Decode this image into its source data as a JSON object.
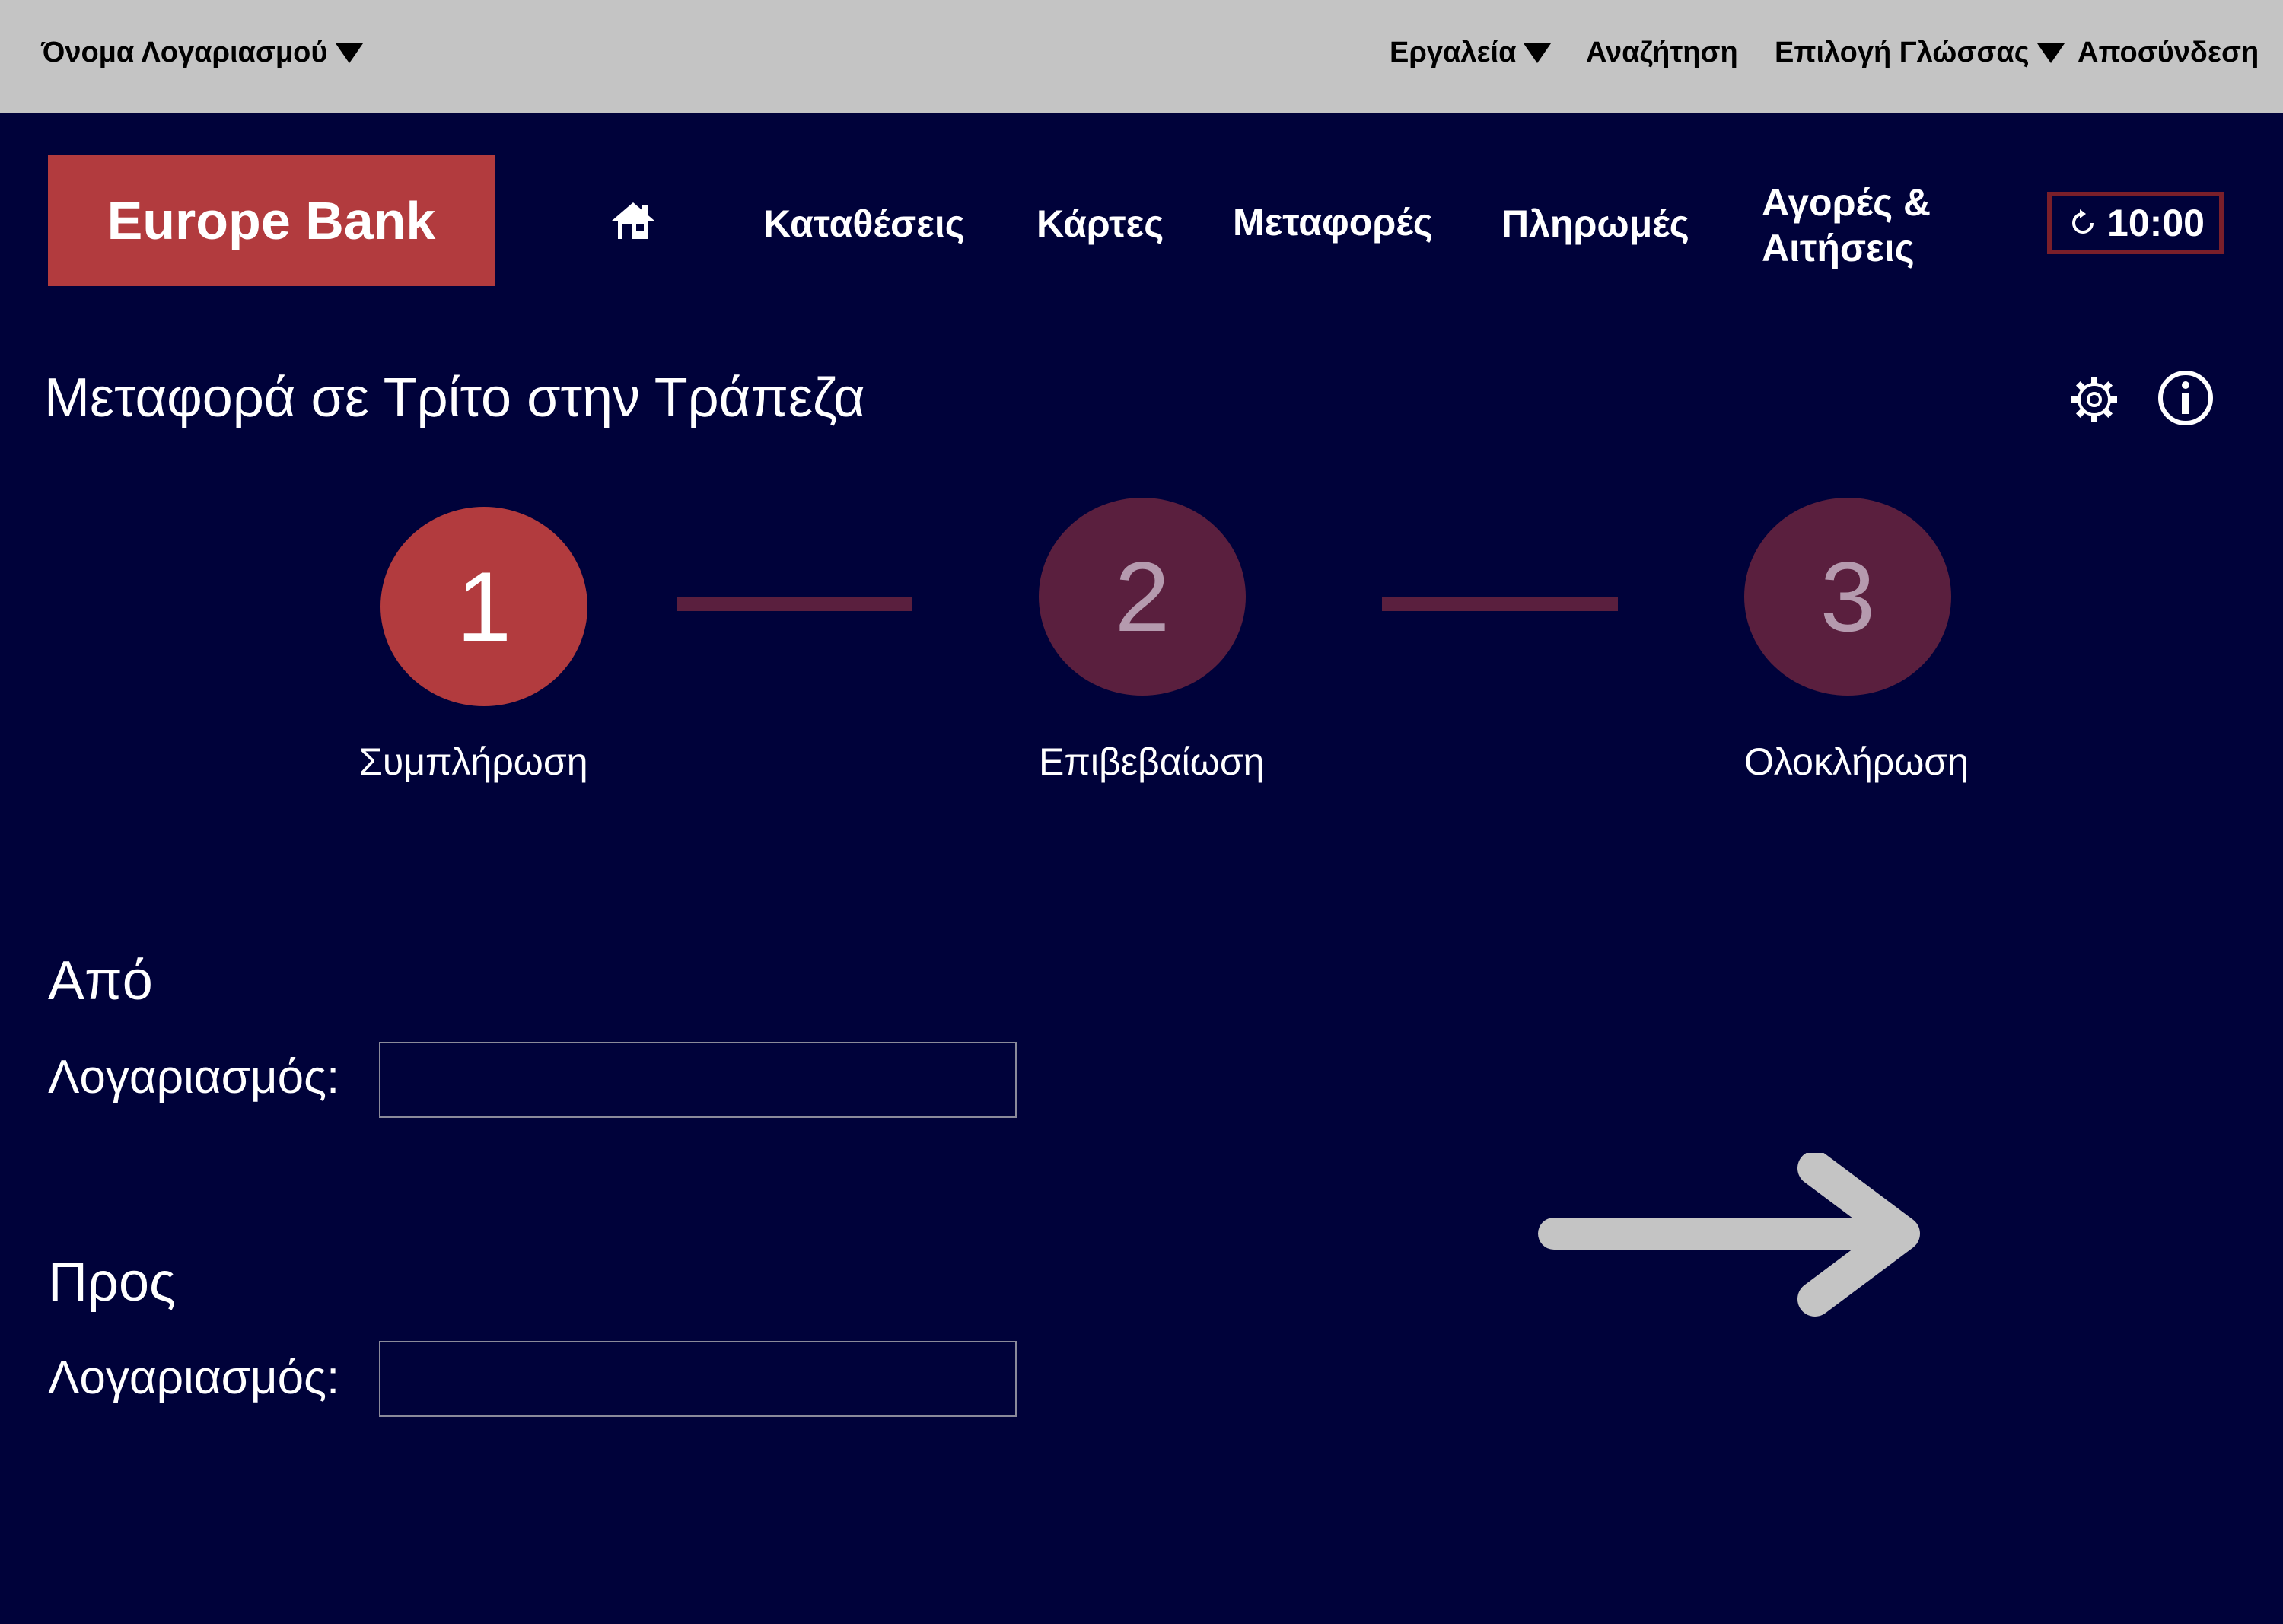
{
  "topbar": {
    "account_name": "Όνομα Λογαριασμού",
    "tools": "Εργαλεία",
    "search": "Αναζήτηση",
    "language": "Επιλογή Γλώσσας",
    "logout": "Αποσύνδεση"
  },
  "brand": {
    "name": "Europe Bank"
  },
  "nav": {
    "deposits": "Καταθέσεις",
    "cards": "Κάρτες",
    "transfers": "Μεταφορές",
    "payments": "Πληρωμές",
    "purchases_line1": "Αγορές &",
    "purchases_line2": "Αιτήσεις"
  },
  "session": {
    "timer": "10:00"
  },
  "page": {
    "title": "Μεταφορά σε Τρίτο στην Τράπεζα"
  },
  "steps": [
    {
      "number": "1",
      "label": "Συμπλήρωση"
    },
    {
      "number": "2",
      "label": "Επιβεβαίωση"
    },
    {
      "number": "3",
      "label": "Ολοκλήρωση"
    }
  ],
  "form": {
    "from_title": "Από",
    "from_label": "Λογαριασμός:",
    "from_value": "",
    "to_title": "Προς",
    "to_label": "Λογαριασμός:",
    "to_value": ""
  },
  "colors": {
    "background": "#00023a",
    "topbar": "#c4c4c4",
    "brand": "#b23b3e",
    "step_active": "#b23b3e",
    "step_inactive": "#5a1f3e",
    "arrow": "#c4c4c4"
  }
}
